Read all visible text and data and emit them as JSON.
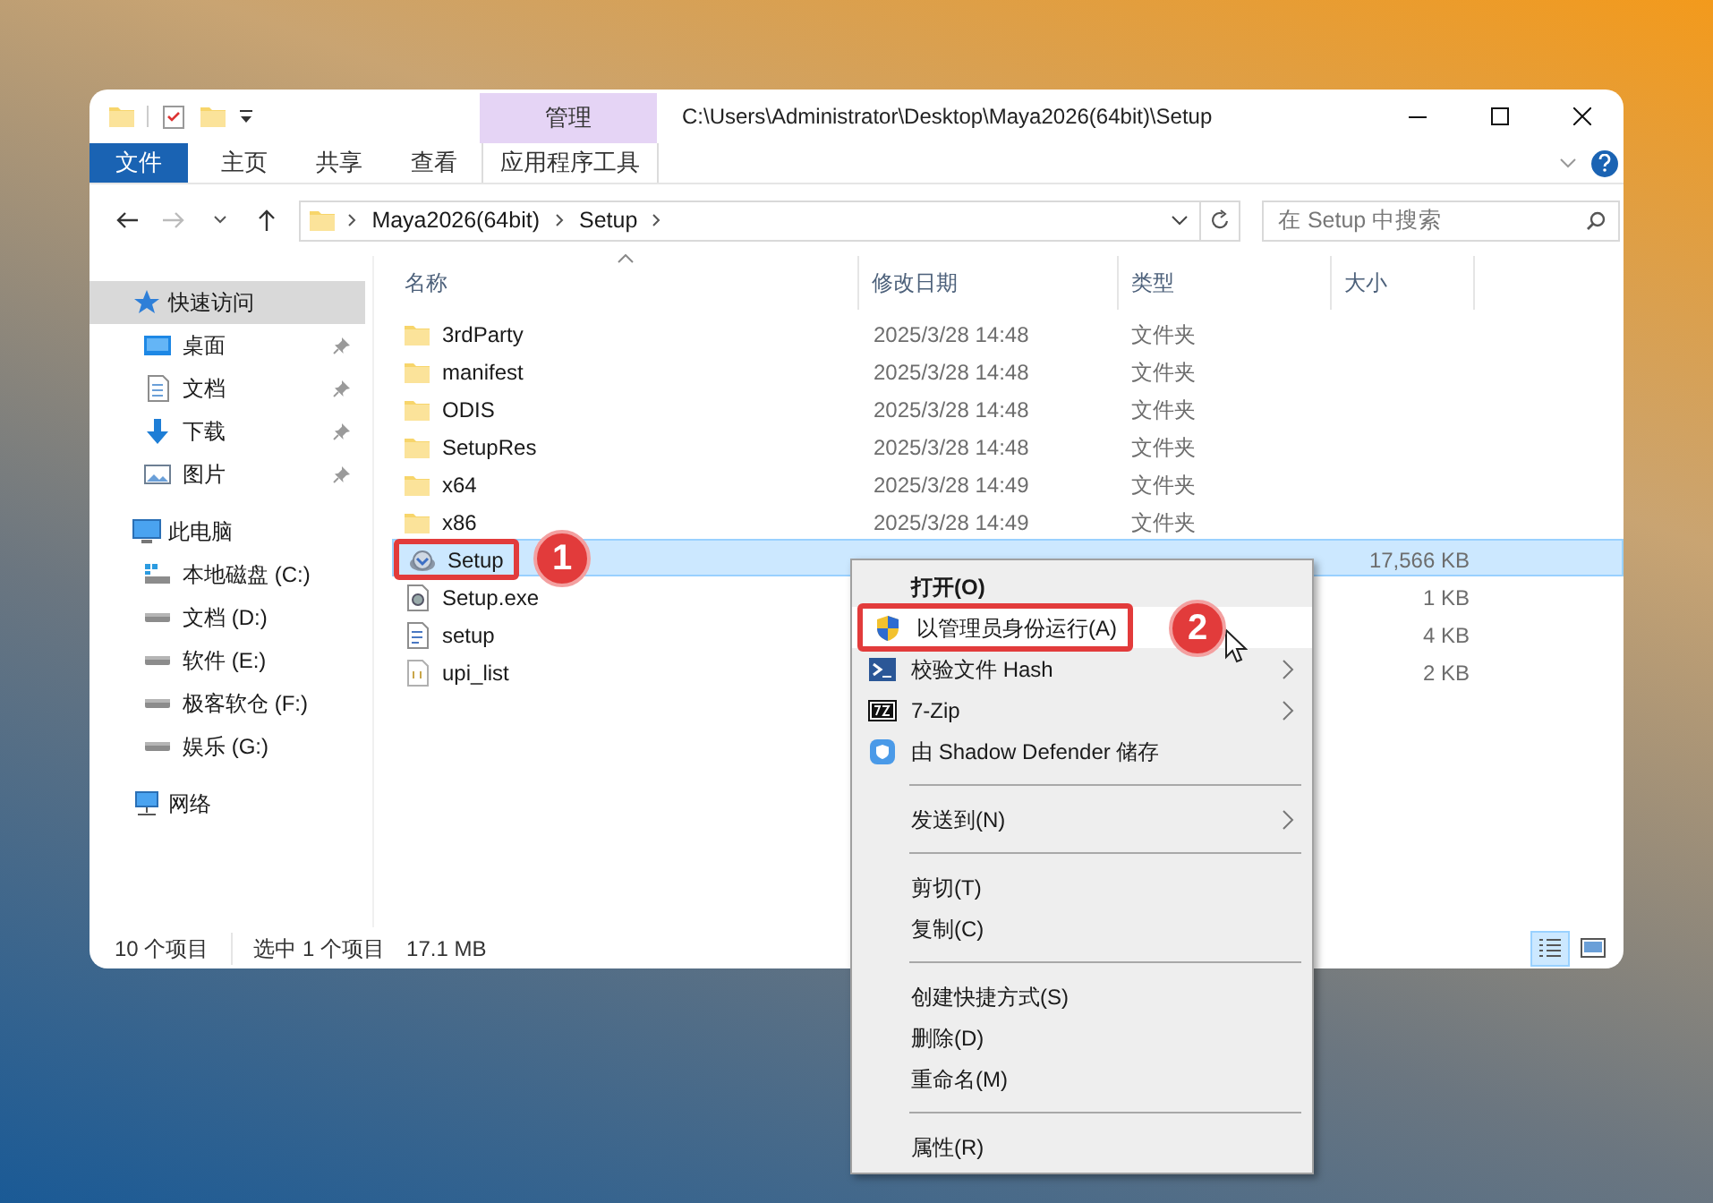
{
  "title_bar": {
    "context_tab": "管理",
    "path": "C:\\Users\\Administrator\\Desktop\\Maya2026(64bit)\\Setup"
  },
  "ribbon_tabs": [
    {
      "label": "文件",
      "kind": "file"
    },
    {
      "label": "主页",
      "kind": "tab"
    },
    {
      "label": "共享",
      "kind": "tab"
    },
    {
      "label": "查看",
      "kind": "tab"
    },
    {
      "label": "应用程序工具",
      "kind": "context"
    }
  ],
  "address_bar": {
    "crumbs": [
      "Maya2026(64bit)",
      "Setup"
    ]
  },
  "search": {
    "placeholder": "在 Setup 中搜索"
  },
  "nav_pane": {
    "groups": [
      {
        "label": "快速访问",
        "kind": "quick-access",
        "selected": true,
        "children": [
          {
            "label": "桌面",
            "kind": "desktop",
            "pinned": true,
            "selected": false
          },
          {
            "label": "文档",
            "kind": "documents",
            "pinned": true,
            "selected": false
          },
          {
            "label": "下载",
            "kind": "downloads",
            "pinned": true,
            "selected": false
          },
          {
            "label": "图片",
            "kind": "pictures",
            "pinned": true,
            "selected": false
          }
        ]
      },
      {
        "label": "此电脑",
        "kind": "this-pc",
        "selected": false,
        "children": [
          {
            "label": "本地磁盘 (C:)",
            "kind": "system-drive",
            "pinned": false,
            "selected": false
          },
          {
            "label": "文档 (D:)",
            "kind": "drive",
            "pinned": false,
            "selected": false
          },
          {
            "label": "软件 (E:)",
            "kind": "drive",
            "pinned": false,
            "selected": false
          },
          {
            "label": "极客软仓 (F:)",
            "kind": "drive",
            "pinned": false,
            "selected": false
          },
          {
            "label": "娱乐 (G:)",
            "kind": "drive",
            "pinned": false,
            "selected": false
          }
        ]
      },
      {
        "label": "网络",
        "kind": "network",
        "selected": false
      }
    ]
  },
  "file_list": {
    "columns": [
      "名称",
      "修改日期",
      "类型",
      "大小"
    ],
    "rows": [
      {
        "name": "3rdParty",
        "kind": "folder",
        "modified": "2025/3/28 14:48",
        "type": "文件夹",
        "selected": false
      },
      {
        "name": "manifest",
        "kind": "folder",
        "modified": "2025/3/28 14:48",
        "type": "文件夹",
        "selected": false
      },
      {
        "name": "ODIS",
        "kind": "folder",
        "modified": "2025/3/28 14:48",
        "type": "文件夹",
        "selected": false
      },
      {
        "name": "SetupRes",
        "kind": "folder",
        "modified": "2025/3/28 14:48",
        "type": "文件夹",
        "selected": false
      },
      {
        "name": "x64",
        "kind": "folder",
        "modified": "2025/3/28 14:49",
        "type": "文件夹",
        "selected": false
      },
      {
        "name": "x86",
        "kind": "folder",
        "modified": "2025/3/28 14:49",
        "type": "文件夹",
        "selected": false
      },
      {
        "name": "Setup",
        "kind": "installer",
        "size": "17,566 KB",
        "selected": true,
        "callout": "1"
      },
      {
        "name": "Setup.exe",
        "kind": "exe",
        "size": "1 KB",
        "selected": false
      },
      {
        "name": "setup",
        "kind": "config",
        "size": "4 KB",
        "selected": false
      },
      {
        "name": "upi_list",
        "kind": "text",
        "size": "2 KB",
        "selected": false
      }
    ]
  },
  "context_menu": {
    "items": [
      {
        "kind": "plain",
        "label": "打开(O)",
        "bold": true,
        "submenu": false,
        "hovered": false
      },
      {
        "kind": "shield",
        "label": "以管理员身份运行(A)",
        "bold": false,
        "submenu": false,
        "hovered": true,
        "callout": "2"
      },
      {
        "kind": "terminal",
        "label": "校验文件 Hash",
        "bold": false,
        "submenu": true,
        "hovered": false
      },
      {
        "kind": "archive",
        "label": "7-Zip",
        "bold": false,
        "submenu": true,
        "hovered": false
      },
      {
        "kind": "shield-app",
        "label": "由 Shadow Defender 储存",
        "bold": false,
        "submenu": false,
        "hovered": false
      },
      {
        "kind": "separator"
      },
      {
        "kind": "plain",
        "label": "发送到(N)",
        "bold": false,
        "submenu": true,
        "hovered": false
      },
      {
        "kind": "separator"
      },
      {
        "kind": "plain",
        "label": "剪切(T)",
        "bold": false,
        "submenu": false,
        "hovered": false
      },
      {
        "kind": "plain",
        "label": "复制(C)",
        "bold": false,
        "submenu": false,
        "hovered": false
      },
      {
        "kind": "separator"
      },
      {
        "kind": "plain",
        "label": "创建快捷方式(S)",
        "bold": false,
        "submenu": false,
        "hovered": false
      },
      {
        "kind": "plain",
        "label": "删除(D)",
        "bold": false,
        "submenu": false,
        "hovered": false
      },
      {
        "kind": "plain",
        "label": "重命名(M)",
        "bold": false,
        "submenu": false,
        "hovered": false
      },
      {
        "kind": "separator"
      },
      {
        "kind": "plain",
        "label": "属性(R)",
        "bold": false,
        "submenu": false,
        "hovered": false
      }
    ]
  },
  "status_bar": {
    "item_count": "10 个项目",
    "selection": "选中 1 个项目",
    "selection_size": "17.1 MB",
    "view_buttons": [
      {
        "kind": "details",
        "selected": true
      },
      {
        "kind": "large-icons",
        "selected": false
      }
    ]
  }
}
